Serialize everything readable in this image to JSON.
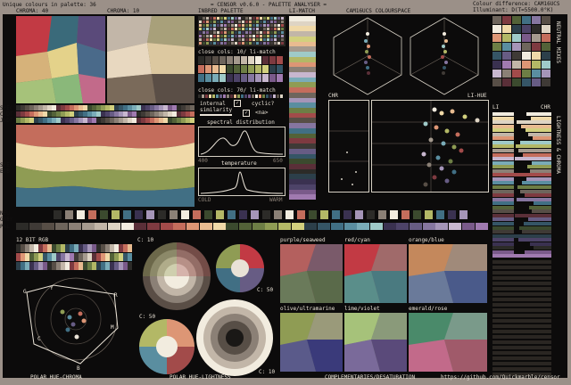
{
  "header": {
    "unique_colours": "Unique colours in palette: 36",
    "title": "= CENSOR v0.6.0 - PALETTE ANALYSER =",
    "colour_difference": "Colour difference: CAM16UCS",
    "illuminant": "Illuminant: D(T=5500.0°K)"
  },
  "labels": {
    "chroma40": "CHROMA: 40",
    "chroma10": "CHROMA: 10",
    "inbred": "INBRED PALETTE",
    "limatch": "LI-MATCH",
    "cam16": "CAM16UCS COLOURSPACE",
    "close10": "close cols: 10/ li-match",
    "close70": "close cols: 70/ li-match",
    "internal": "internal",
    "similarity": "similarity",
    "cyclic": "cyclic?",
    "na": "<na>",
    "spectral": "spectral distribution",
    "nm400": "400",
    "nm650": "650",
    "temperature": "temperature",
    "cold": "COLD",
    "warm": "WARM",
    "chr": "CHR",
    "lihue": "LI-HUE",
    "li": "LI",
    "chr2": "CHR",
    "neu": "NEU",
    "grey": "GREY",
    "pal": "PAL",
    "spec": "SPEC",
    "csdt": "CSDT",
    "jsdt": "JSDT",
    "spec2": "SPEC",
    "edb": "EDB",
    "bit12": "12 BIT RGB",
    "c10a": "C: 10",
    "c50a": "C: 50",
    "c50b": "C: 50",
    "c10b": "C: 10",
    "purple_seaweed": "purple/seaweed",
    "red_cyan": "red/cyan",
    "orange_blue": "orange/blue",
    "olive_ultramarine": "olive/ultramarine",
    "lime_violet": "lime/violet",
    "emerald_rose": "emerald/rose",
    "polar_hue_chroma": "POLAR HUE-CHROMA",
    "polar_hue_lightness": "POLAR HUE-LIGHTNESS",
    "complementaries": "COMPLEMENTARIES/DESATURATION",
    "url": "https://github.com/Quickmarble/censor",
    "side_vertical": "NEUTRAL MIXES",
    "side_vertical2": "LIGHTNESS & CHROMA",
    "hue_letters": [
      "G",
      "Y",
      "R",
      "C",
      "M",
      "B"
    ]
  },
  "palette": [
    "#2c2b28",
    "#3f3a36",
    "#574e46",
    "#6e655c",
    "#8b8076",
    "#a59a8e",
    "#c2b6a8",
    "#ded4c4",
    "#f2ecdf",
    "#5a2f38",
    "#7e3a40",
    "#a24b4a",
    "#c46d5c",
    "#dd9675",
    "#e8bb90",
    "#f0d9a8",
    "#3b4a2e",
    "#536238",
    "#6d7e45",
    "#8f9c54",
    "#b3b866",
    "#d2d07e",
    "#2c3f4a",
    "#355566",
    "#416f84",
    "#5a8ea0",
    "#7aacb8",
    "#9fcac8",
    "#3a3150",
    "#4d4368",
    "#675c84",
    "#8676a0",
    "#a595b8",
    "#c8b7cf",
    "#7a5a8a",
    "#a07ab0"
  ],
  "colors": {
    "accent": "#9b9088",
    "frame": "#d6d0c4",
    "background": "#0c0b0b"
  }
}
